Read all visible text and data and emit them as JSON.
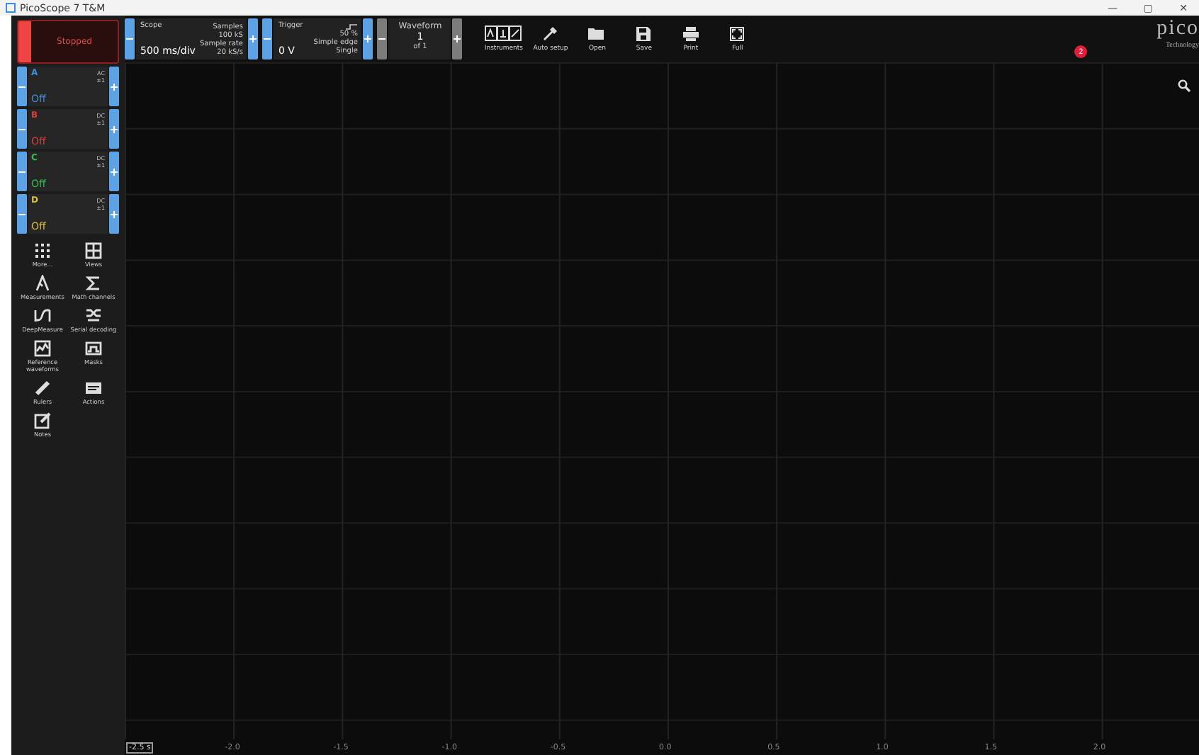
{
  "window": {
    "title": "PicoScope 7 T&M",
    "controls": [
      "—",
      "▢",
      "✕"
    ]
  },
  "run_button": {
    "label": "Stopped",
    "running": false
  },
  "scope": {
    "title": "Scope",
    "value": "500 ms/div",
    "details": [
      {
        "label": "Samples",
        "value": "100 kS"
      },
      {
        "label": "Sample rate",
        "value": "20 kS/s"
      }
    ]
  },
  "trigger": {
    "title": "Trigger",
    "value": "0 V",
    "details": [
      "50 %",
      "Simple edge",
      "Single"
    ]
  },
  "waveform": {
    "title": "Waveform",
    "value": "1",
    "of": "of 1"
  },
  "toolbar": [
    {
      "kind": "instruments",
      "label": "Instruments"
    },
    {
      "kind": "wand",
      "label": "Auto setup"
    },
    {
      "kind": "folder",
      "label": "Open"
    },
    {
      "kind": "save",
      "label": "Save"
    },
    {
      "kind": "print",
      "label": "Print"
    },
    {
      "kind": "full",
      "label": "Full"
    }
  ],
  "logo": {
    "name": "pico",
    "tagline": "Technology",
    "badge": "2"
  },
  "channels": [
    {
      "name": "A",
      "coupling": "AC",
      "range": "±1",
      "state": "Off",
      "color": "#3b8fe0"
    },
    {
      "name": "B",
      "coupling": "DC",
      "range": "±1",
      "state": "Off",
      "color": "#e03a3a"
    },
    {
      "name": "C",
      "coupling": "DC",
      "range": "±1",
      "state": "Off",
      "color": "#2fc24a"
    },
    {
      "name": "D",
      "coupling": "DC",
      "range": "±1",
      "state": "Off",
      "color": "#e0c030"
    }
  ],
  "tools": [
    {
      "kind": "dots",
      "label": "More..."
    },
    {
      "kind": "views",
      "label": "Views"
    },
    {
      "kind": "caliper",
      "label": "Measurements"
    },
    {
      "kind": "sigma",
      "label": "Math channels"
    },
    {
      "kind": "deep",
      "label": "DeepMeasure"
    },
    {
      "kind": "serial",
      "label": "Serial decoding"
    },
    {
      "kind": "reference",
      "label": "Reference waveforms"
    },
    {
      "kind": "mask",
      "label": "Masks"
    },
    {
      "kind": "ruler",
      "label": "Rulers"
    },
    {
      "kind": "actions",
      "label": "Actions"
    },
    {
      "kind": "notes",
      "label": "Notes"
    }
  ],
  "x_axis": {
    "ticks": [
      {
        "label": "-2.5 s",
        "current": true
      },
      {
        "label": "-2.0",
        "current": false
      },
      {
        "label": "-1.5",
        "current": false
      },
      {
        "label": "-1.0",
        "current": false
      },
      {
        "label": "-0.5",
        "current": false
      },
      {
        "label": "0.0",
        "current": false
      },
      {
        "label": "0.5",
        "current": false
      },
      {
        "label": "1.0",
        "current": false
      },
      {
        "label": "1.5",
        "current": false
      },
      {
        "label": "2.0",
        "current": false
      }
    ]
  }
}
